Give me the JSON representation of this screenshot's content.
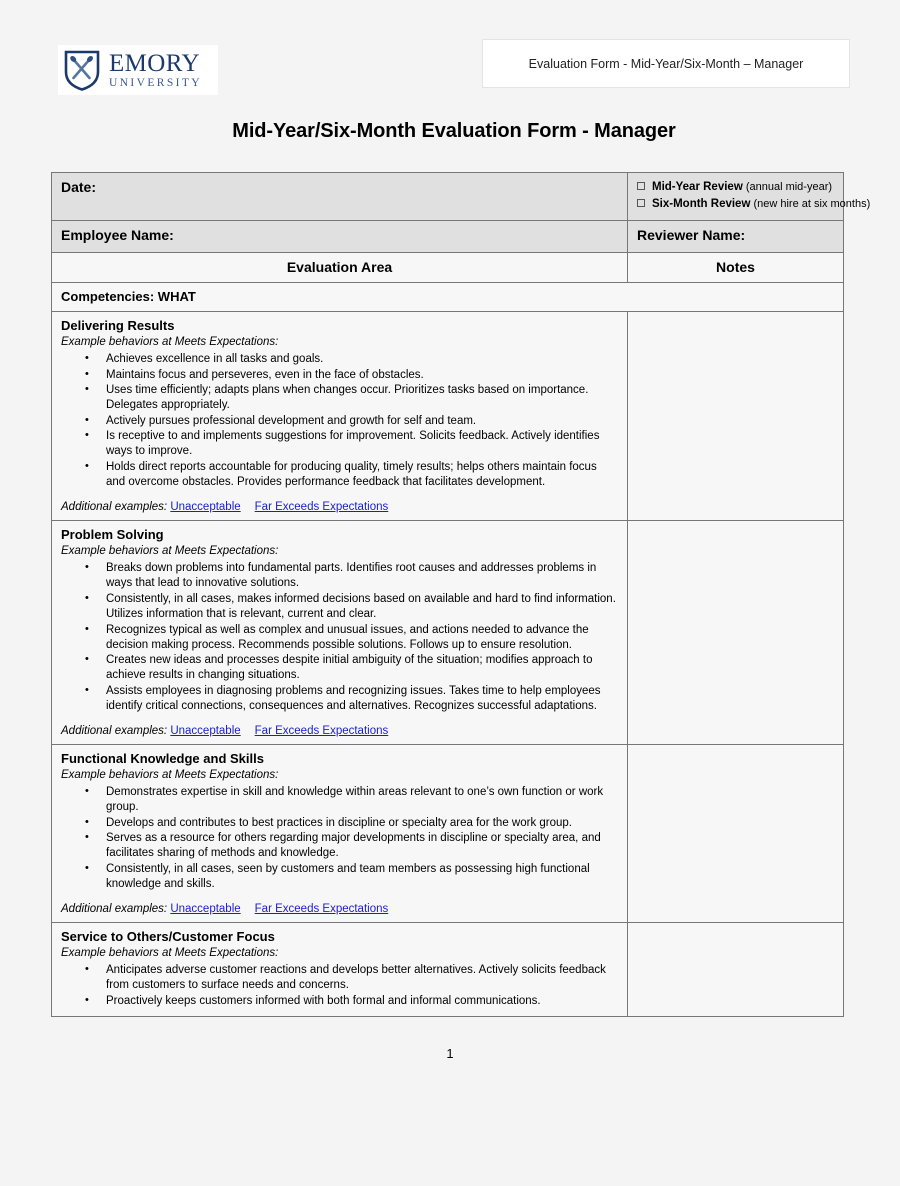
{
  "header": {
    "logo": {
      "shield_icon": "emory-shield-icon",
      "wordmark_primary": "EMORY",
      "wordmark_secondary": "UNIVERSITY",
      "brand_color": "#1b3a6b"
    },
    "doc_tag": "Evaluation Form - Mid-Year/Six-Month – Manager",
    "title": "Mid-Year/Six-Month Evaluation Form - Manager"
  },
  "form": {
    "date_label": "Date:",
    "review_options": [
      {
        "checkbox": "unchecked",
        "label": "Mid-Year Review",
        "note": "(annual mid-year)"
      },
      {
        "checkbox": "unchecked",
        "label": "Six-Month Review",
        "note": "(new hire at six months)"
      }
    ],
    "employee_name_label": "Employee Name:",
    "reviewer_name_label": "Reviewer Name:",
    "column_headers": {
      "evaluation_area": "Evaluation Area",
      "notes": "Notes"
    },
    "competencies_heading": "Competencies:  WHAT",
    "additional_examples_label": "Additional examples:",
    "link_unacceptable": "Unacceptable",
    "link_far_exceeds": "Far Exceeds Expectations",
    "example_behaviors_label": "Example behaviors at Meets Expectations:",
    "sections": [
      {
        "title": "Delivering Results",
        "subtitle": "Example behaviors at Meets Expectations:",
        "bullets": [
          "Achieves excellence in all tasks and goals.",
          "Maintains focus and perseveres, even in the face of obstacles.",
          "Uses time efficiently; adapts plans when changes occur. Prioritizes tasks based on importance. Delegates appropriately.",
          "Actively pursues professional development and growth for self and team.",
          "Is receptive to and implements suggestions for improvement. Solicits feedback. Actively identifies ways to improve.",
          "Holds direct reports accountable for producing quality, timely results; helps others maintain focus and overcome obstacles. Provides performance feedback that facilitates development."
        ],
        "notes": ""
      },
      {
        "title": "Problem Solving",
        "subtitle": "Example behaviors at Meets Expectations:",
        "bullets": [
          "Breaks down problems into fundamental parts. Identifies root causes and addresses problems in ways that lead to innovative solutions.",
          "Consistently, in all cases, makes informed decisions based on available and hard to find information. Utilizes information that is relevant, current and clear.",
          "Recognizes typical as well as complex and unusual issues, and actions needed to advance the decision making process. Recommends possible solutions. Follows up to ensure resolution.",
          "Creates new ideas and processes despite initial ambiguity of the situation; modifies approach to achieve results in changing situations.",
          "Assists employees in diagnosing problems and recognizing issues. Takes time to help employees identify critical connections, consequences and alternatives. Recognizes successful adaptations."
        ],
        "notes": ""
      },
      {
        "title": "Functional Knowledge and Skills",
        "subtitle": "Example behaviors at Meets Expectations:",
        "bullets": [
          "Demonstrates expertise in skill and knowledge within areas relevant to one’s own function or work group.",
          "Develops and contributes to best practices in discipline or specialty area for the work group.",
          "Serves as a resource for others regarding major developments in discipline or specialty area, and facilitates sharing of methods and knowledge.",
          "Consistently, in all cases, seen by customers and team members as possessing high functional knowledge and skills."
        ],
        "notes": ""
      },
      {
        "title": "Service to Others/Customer Focus",
        "subtitle": "Example behaviors at Meets Expectations:",
        "bullets": [
          "Anticipates adverse customer reactions and develops better alternatives. Actively solicits feedback from customers to surface needs and concerns.",
          "Proactively keeps customers informed with both formal and informal communications."
        ],
        "notes": ""
      }
    ]
  },
  "footer": {
    "page_number": "1"
  }
}
